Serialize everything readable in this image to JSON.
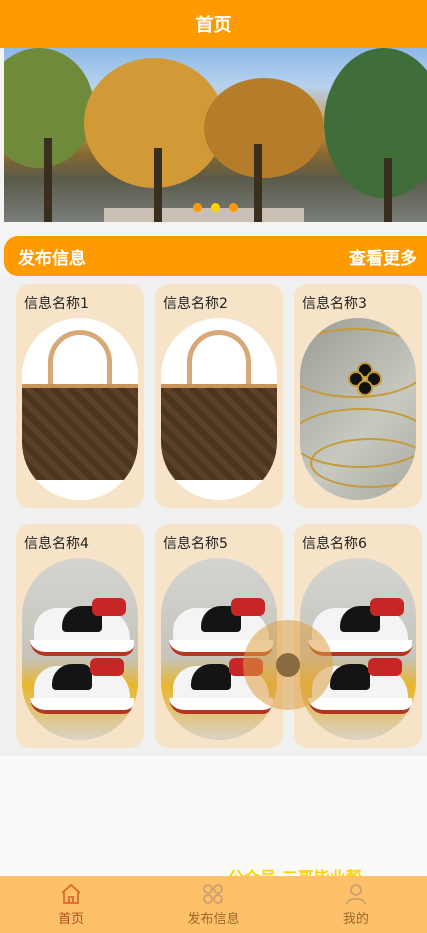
{
  "header": {
    "title": "首页"
  },
  "banner": {
    "slides": 3,
    "active_slide": 2
  },
  "section": {
    "title": "发布信息",
    "more_label": "查看更多"
  },
  "items": [
    {
      "name": "信息名称1",
      "image": "handbag"
    },
    {
      "name": "信息名称2",
      "image": "handbag"
    },
    {
      "name": "信息名称3",
      "image": "necklace"
    },
    {
      "name": "信息名称4",
      "image": "sneakers"
    },
    {
      "name": "信息名称5",
      "image": "sneakers"
    },
    {
      "name": "信息名称6",
      "image": "sneakers"
    }
  ],
  "watermark": "公众号 二哥毕业帮",
  "tabbar": {
    "items": [
      {
        "label": "首页",
        "icon": "home-icon",
        "active": true
      },
      {
        "label": "发布信息",
        "icon": "grid-icon",
        "active": false
      },
      {
        "label": "我的",
        "icon": "user-icon",
        "active": false
      }
    ]
  },
  "colors": {
    "accent": "#ff9a00",
    "card_bg": "#f7e3c8",
    "tab_bg": "#ffc06a"
  }
}
